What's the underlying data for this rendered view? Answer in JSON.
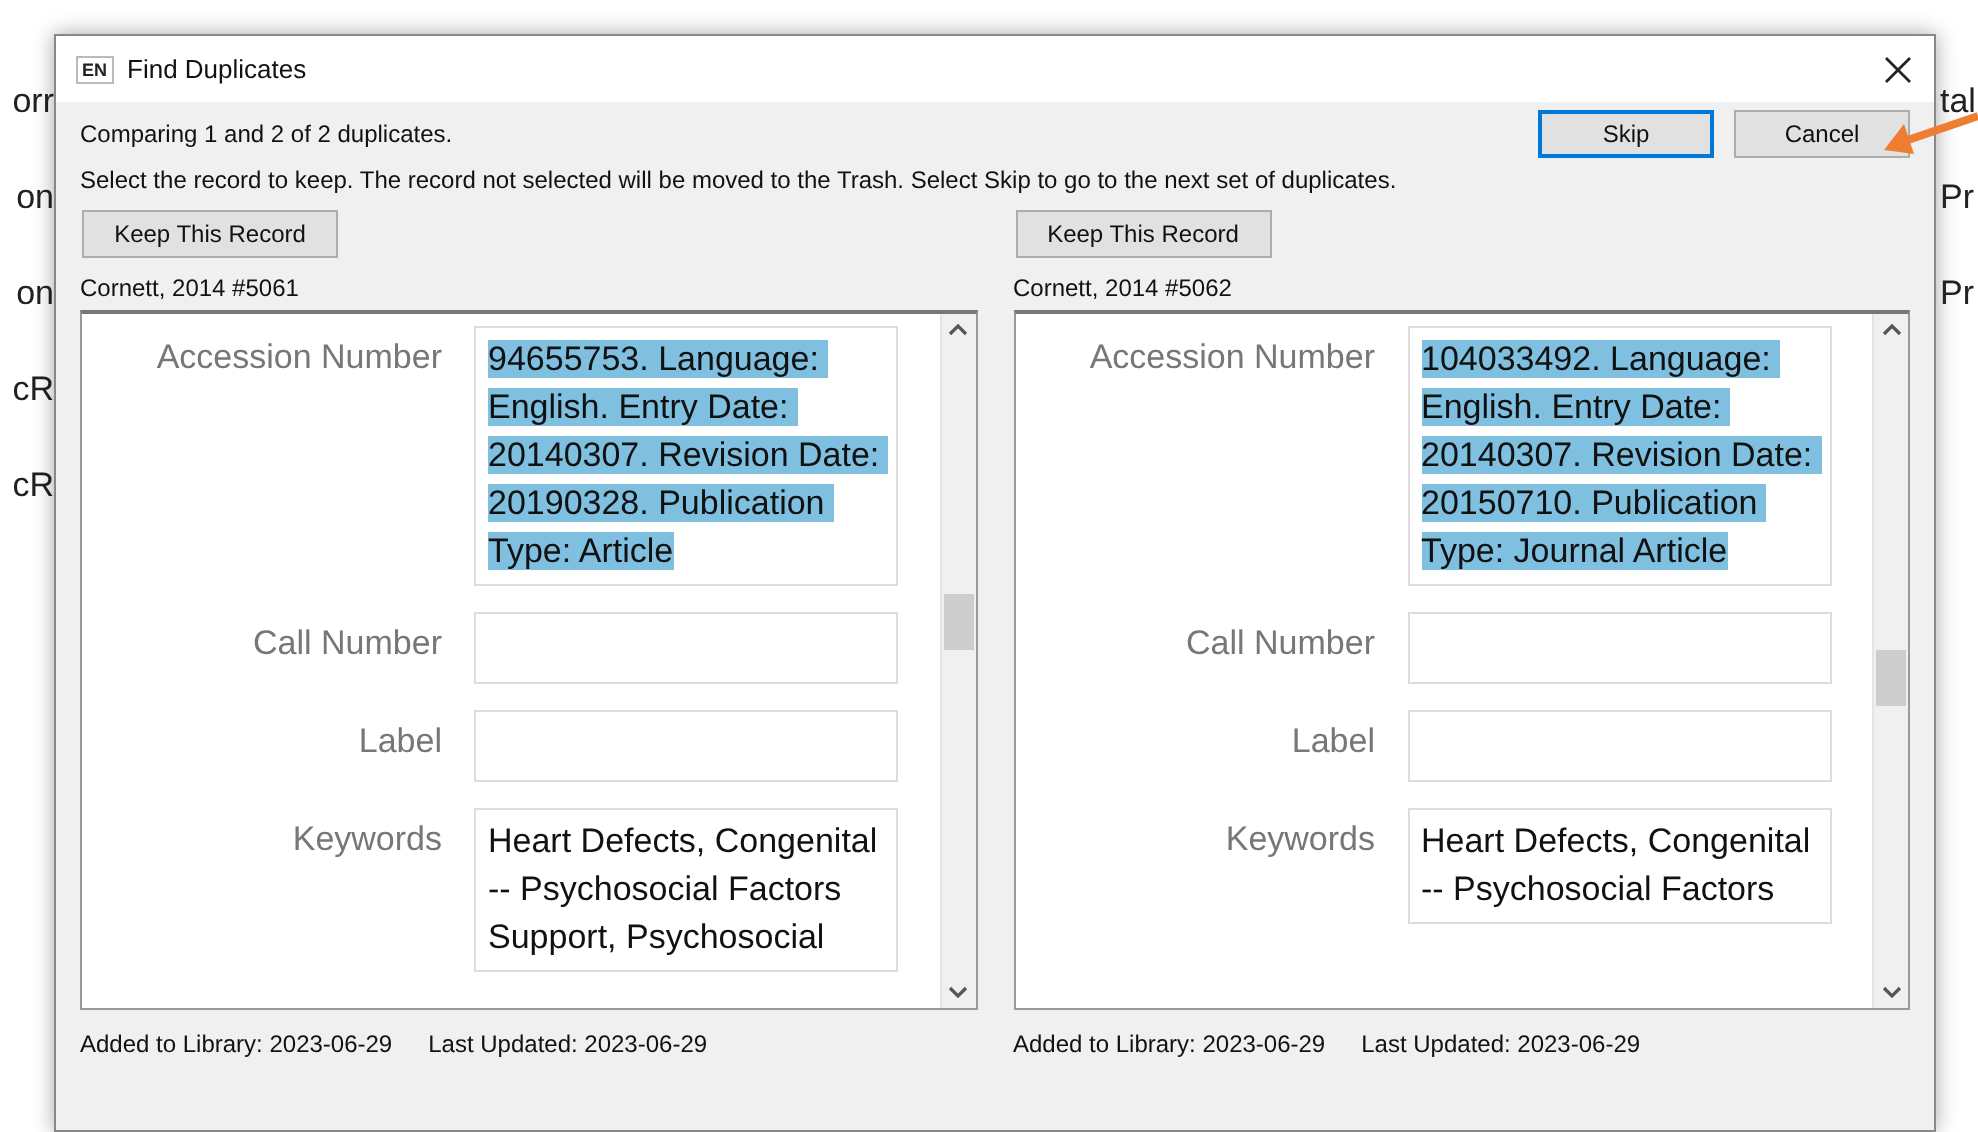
{
  "background": {
    "left": [
      "orr",
      "on",
      "on",
      "cR",
      "cR"
    ],
    "right": [
      "tal",
      "Pr",
      "Pr"
    ]
  },
  "window": {
    "badge": "EN",
    "title": "Find Duplicates"
  },
  "status": "Comparing 1 and 2 of 2 duplicates.",
  "buttons": [
    {
      "label": "Skip",
      "default": true
    },
    {
      "label": "Cancel",
      "default": false
    }
  ],
  "instructions": "Select the record to keep. The record not selected will be moved to the Trash. Select Skip to go to the next set of duplicates.",
  "records": [
    {
      "keep_button": "Keep This Record",
      "reference": "Cornett, 2014 #5061",
      "fields": [
        {
          "label": "Accession Number",
          "value": "94655753. Language: English. Entry Date: 20140307. Revision Date: 20190328. Publication Type: Article",
          "highlighted": true
        },
        {
          "label": "Call Number"
        },
        {
          "label": "Label"
        },
        {
          "label": "Keywords",
          "value": "Heart Defects, Congenital -- Psychosocial Factors\nSupport, Psychosocial",
          "highlighted": false
        }
      ],
      "added": "Added to Library: 2023-06-29",
      "updated": "Last Updated: 2023-06-29"
    },
    {
      "keep_button": "Keep This Record",
      "reference": "Cornett, 2014 #5062",
      "fields": [
        {
          "label": "Accession Number",
          "value": "104033492. Language: English. Entry Date: 20140307. Revision Date: 20150710. Publication Type: Journal Article",
          "highlighted": true
        },
        {
          "label": "Call Number"
        },
        {
          "label": "Label"
        },
        {
          "label": "Keywords",
          "value": "Heart Defects, Congenital -- Psychosocial Factors",
          "highlighted": false
        }
      ],
      "added": "Added to Library: 2023-06-29",
      "updated": "Last Updated: 2023-06-29"
    }
  ]
}
